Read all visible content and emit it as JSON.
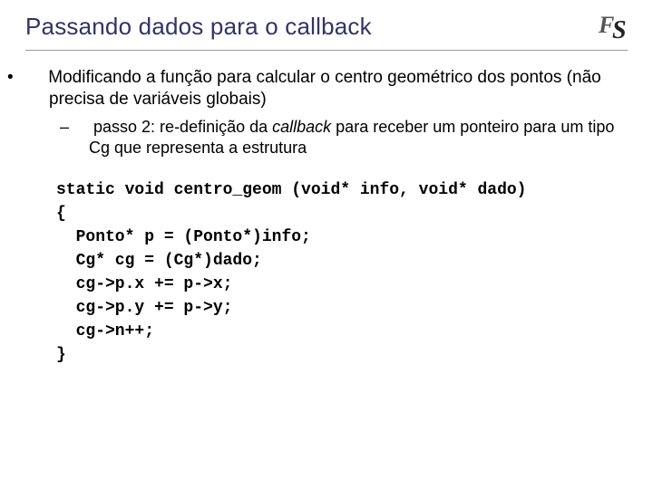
{
  "title": "Passando dados para o callback",
  "logo_text": "FS",
  "bullet1": "Modificando a função para calcular o centro geométrico dos pontos (não precisa de variáveis globais)",
  "sub1_a": "passo 2: re-definição da ",
  "sub1_cb": "callback",
  "sub1_b": " para receber um ponteiro para um tipo Cg que representa a estrutura",
  "code": "static void centro_geom (void* info, void* dado)\n{\n  Ponto* p = (Ponto*)info;\n  Cg* cg = (Cg*)dado;\n  cg->p.x += p->x;\n  cg->p.y += p->y;\n  cg->n++;\n}"
}
